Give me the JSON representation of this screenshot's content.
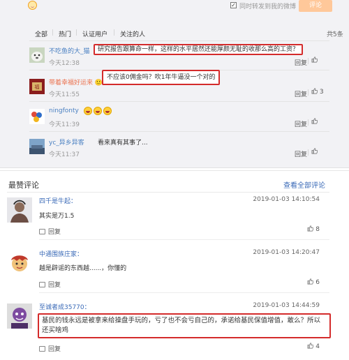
{
  "composer": {
    "checkbox_mark": "✓",
    "checkbox_label": "同时转发到我的微博",
    "post_label": "评论"
  },
  "filters": {
    "items": [
      "全部",
      "热门",
      "认证用户",
      "关注的人"
    ],
    "separator": "|",
    "total": "共5条",
    "chevron": "﹀"
  },
  "comments": [
    {
      "name": "不吃鱼的大_猫",
      "text": "研究报告跟算命一样，这样的水平居然还能厚颜无耻的收那么高的工资？",
      "time": "今天12:38",
      "reply": "回复",
      "likes": ""
    },
    {
      "name": "带着幸福好运来",
      "badge": "🙂",
      "text": "不应该0佣金吗？吹1年牛逼没一个对的",
      "time": "今天11:55",
      "reply": "回复",
      "likes": "3"
    },
    {
      "name": "ningfonty",
      "text": "",
      "emoji_count": 3,
      "time": "今天11:39",
      "reply": "回复",
      "likes": ""
    },
    {
      "name": "yc_异乡异客",
      "text": "看来真有其事了...",
      "time": "今天11:37",
      "reply": "回复",
      "likes": ""
    }
  ],
  "hot": {
    "title": "最赞评论",
    "view_all": "查看全部评论",
    "items": [
      {
        "name": "四千是牛起：",
        "time": "2019-01-03 14:10:54",
        "text": "其实是万1.5",
        "reply": "回复",
        "likes": "8"
      },
      {
        "name": "中通围族庄家：",
        "time": "2019-01-03 14:20:47",
        "text": "越是辟谣的东西越......，你懂的",
        "reply": "回复",
        "likes": "6"
      },
      {
        "name": "至诚者成35770：",
        "time": "2019-01-03 14:44:59",
        "text_line1": "基民的钱永远是被拿来给操盘手玩的，亏了也不会亏自己的，承诺给基民保值增值，敢么？所以",
        "text_line2": "还买啥鸡",
        "reply": "回复",
        "likes": "4"
      }
    ]
  }
}
